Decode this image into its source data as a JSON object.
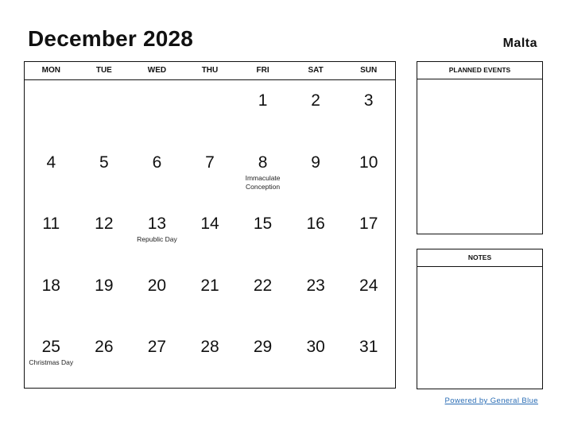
{
  "header": {
    "title": "December 2028",
    "country": "Malta"
  },
  "calendar": {
    "weekdays": [
      "MON",
      "TUE",
      "WED",
      "THU",
      "FRI",
      "SAT",
      "SUN"
    ],
    "weeks": [
      [
        {
          "day": ""
        },
        {
          "day": ""
        },
        {
          "day": ""
        },
        {
          "day": ""
        },
        {
          "day": "1"
        },
        {
          "day": "2"
        },
        {
          "day": "3"
        }
      ],
      [
        {
          "day": "4"
        },
        {
          "day": "5"
        },
        {
          "day": "6"
        },
        {
          "day": "7"
        },
        {
          "day": "8",
          "holiday": "Immaculate Conception"
        },
        {
          "day": "9"
        },
        {
          "day": "10"
        }
      ],
      [
        {
          "day": "11"
        },
        {
          "day": "12"
        },
        {
          "day": "13",
          "holiday": "Republic Day"
        },
        {
          "day": "14"
        },
        {
          "day": "15"
        },
        {
          "day": "16"
        },
        {
          "day": "17"
        }
      ],
      [
        {
          "day": "18"
        },
        {
          "day": "19"
        },
        {
          "day": "20"
        },
        {
          "day": "21"
        },
        {
          "day": "22"
        },
        {
          "day": "23"
        },
        {
          "day": "24"
        }
      ],
      [
        {
          "day": "25",
          "holiday": "Christmas Day"
        },
        {
          "day": "26"
        },
        {
          "day": "27"
        },
        {
          "day": "28"
        },
        {
          "day": "29"
        },
        {
          "day": "30"
        },
        {
          "day": "31"
        }
      ]
    ]
  },
  "panels": {
    "planned_events": "PLANNED EVENTS",
    "notes": "NOTES"
  },
  "footer": {
    "link_text": "Powered by General Blue",
    "link_color": "#2a6db5"
  }
}
